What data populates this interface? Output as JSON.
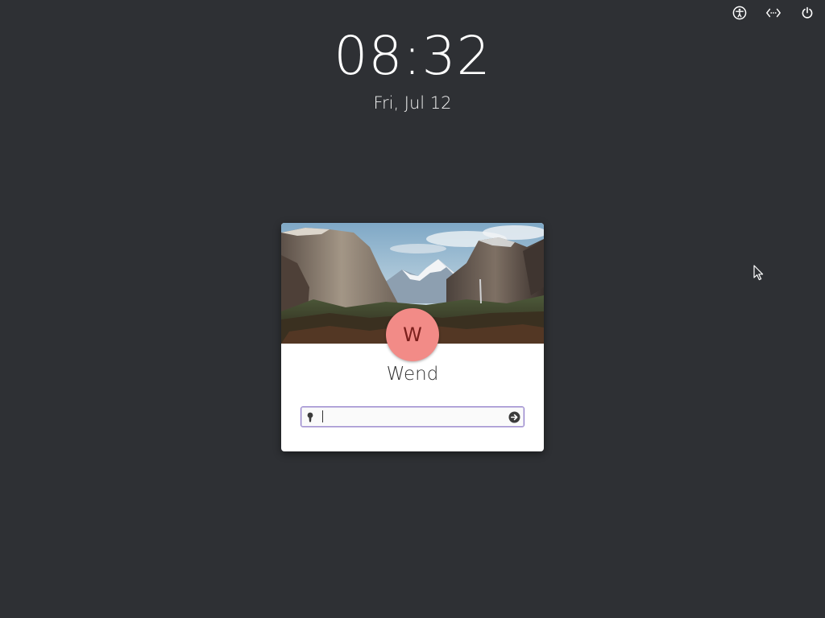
{
  "indicators": {
    "accessibility_icon": "accessibility-icon",
    "network_icon": "network-wired-icon",
    "power_icon": "power-icon"
  },
  "clock": {
    "time": "08:32",
    "date": "Fri, Jul 12"
  },
  "greeter": {
    "avatar_initial": "W",
    "avatar_color": "#f28b87",
    "user_name": "Wend",
    "password": {
      "value": "",
      "placeholder": "",
      "lock_icon": "lock-icon",
      "submit_icon": "arrow-right-circle-icon"
    }
  },
  "colors": {
    "background": "#2e3034",
    "card": "#ffffff",
    "entry_focus": "#8a76c6"
  }
}
